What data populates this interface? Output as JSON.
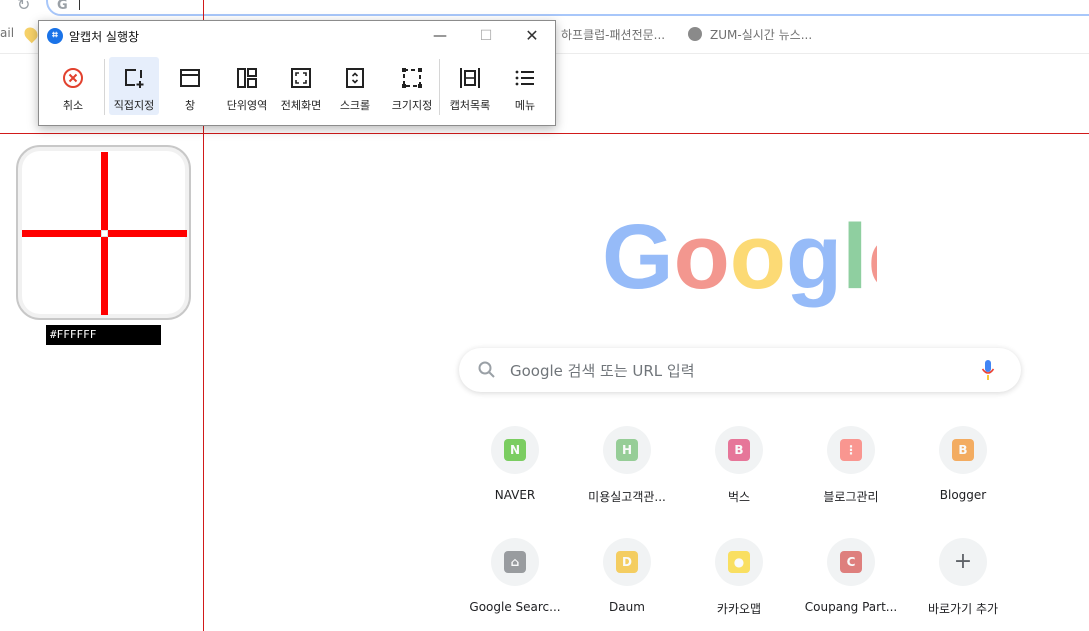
{
  "browser": {
    "bookmarks": [
      "하프클럽-패션전문...",
      "ZUM-실시간 뉴스..."
    ],
    "bookmark_fragment": "ail"
  },
  "capture_window": {
    "title": "알캡처 실행창",
    "app_icon_glyph": "⌗",
    "tools": [
      {
        "label": "취소",
        "icon": "cancel-icon",
        "color": "#e2412e"
      },
      {
        "label": "직접지정",
        "icon": "direct-select-icon",
        "active": true
      },
      {
        "label": "창",
        "icon": "window-icon"
      },
      {
        "label": "단위영역",
        "icon": "unit-area-icon"
      },
      {
        "label": "전체화면",
        "icon": "fullscreen-icon"
      },
      {
        "label": "스크롤",
        "icon": "scroll-icon"
      },
      {
        "label": "크기지정",
        "icon": "size-specify-icon"
      },
      {
        "label": "캡처목록",
        "icon": "capture-list-icon"
      },
      {
        "label": "메뉴",
        "icon": "menu-icon"
      }
    ]
  },
  "magnifier": {
    "color_hex": "#FFFFFF"
  },
  "google": {
    "search_placeholder": "Google 검색 또는 URL 입력",
    "shortcuts": [
      {
        "label": "NAVER",
        "tile": "N",
        "color": "#2db400"
      },
      {
        "label": "미용실고객관...",
        "tile": "H",
        "color": "#5ab55a"
      },
      {
        "label": "벅스",
        "tile": "B",
        "color": "#e0245e"
      },
      {
        "label": "블로그관리",
        "tile": "⋮",
        "color": "#ff5a4f"
      },
      {
        "label": "Blogger",
        "tile": "B",
        "color": "#f57d00"
      },
      {
        "label": "Google Searc...",
        "tile": "⌂",
        "color": "#5f6368"
      },
      {
        "label": "Daum",
        "tile": "D",
        "color": "#f7b500"
      },
      {
        "label": "카카오맵",
        "tile": "●",
        "color": "#ffd200"
      },
      {
        "label": "Coupang Part...",
        "tile": "C",
        "color": "#d2332f"
      },
      {
        "label": "바로가기 추가",
        "tile": "+",
        "color": "#5f6368"
      }
    ]
  }
}
